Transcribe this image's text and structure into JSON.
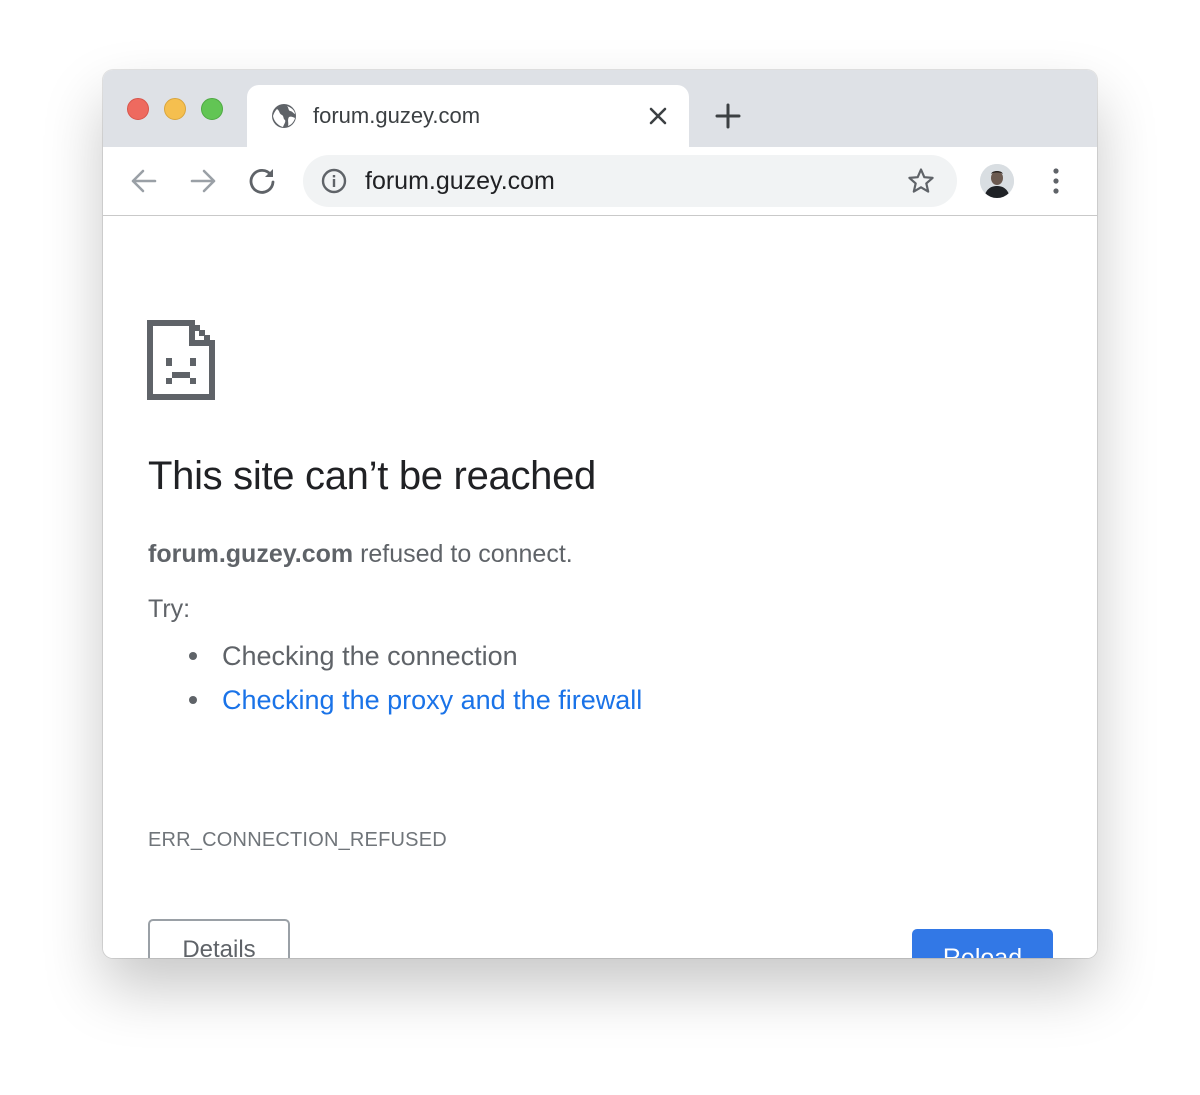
{
  "tab": {
    "title": "forum.guzey.com",
    "favicon": "globe-icon"
  },
  "toolbar": {
    "url": "forum.guzey.com",
    "back_icon": "back-arrow-icon",
    "forward_icon": "forward-arrow-icon",
    "reload_icon": "reload-icon",
    "site_info_icon": "info-icon",
    "bookmark_icon": "star-icon",
    "menu_icon": "kebab-menu-icon"
  },
  "error": {
    "icon": "sad-page-icon",
    "heading": "This site can’t be reached",
    "host": "forum.guzey.com",
    "message": " refused to connect.",
    "try_label": "Try:",
    "suggestions": [
      "Checking the connection",
      "Checking the proxy and the firewall"
    ],
    "code": "ERR_CONNECTION_REFUSED"
  },
  "buttons": {
    "details": "Details",
    "reload": "Reload"
  },
  "colors": {
    "tabstrip": "#dee1e6",
    "link": "#1a73e8",
    "primary_button": "#3278e6",
    "text_secondary": "#5f6368"
  }
}
